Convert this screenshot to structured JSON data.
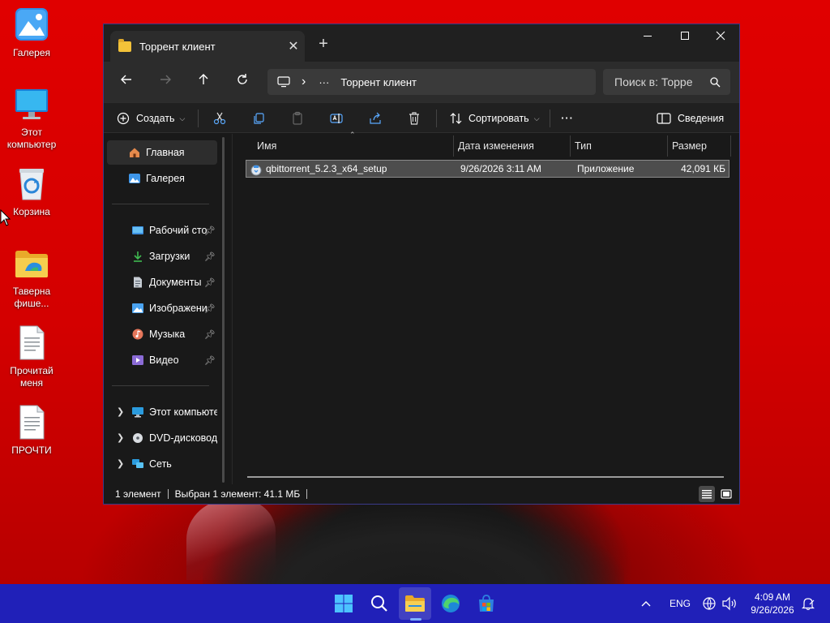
{
  "desktop": {
    "icons": [
      {
        "label": "Галерея",
        "icon": "gallery-icon"
      },
      {
        "label": "Этот компьютер",
        "icon": "monitor-icon"
      },
      {
        "label": "Корзина",
        "icon": "recycle-bin-icon"
      },
      {
        "label": "Таверна фише...",
        "icon": "folder-icon"
      },
      {
        "label": "Прочитай меня",
        "icon": "document-icon"
      },
      {
        "label": "ПРОЧТИ",
        "icon": "document-icon"
      }
    ]
  },
  "window": {
    "tab_title": "Торрент клиент",
    "new_tab_symbol": "+",
    "address": {
      "pc_icon": "monitor-icon",
      "separator": "›",
      "overflow": "···",
      "current_folder": "Торрент клиент"
    },
    "search_placeholder": "Поиск в: Торре",
    "toolbar": {
      "create_label": "Создать",
      "sort_label": "Сортировать",
      "more_label": "···",
      "details_label": "Сведения"
    },
    "sidebar": {
      "home": "Главная",
      "gallery": "Галерея",
      "quick": [
        {
          "label": "Рабочий сто",
          "icon": "desktop-icon",
          "color": "#3b8fe0"
        },
        {
          "label": "Загрузки",
          "icon": "download-icon",
          "color": "#3fb950"
        },
        {
          "label": "Документы",
          "icon": "documents-icon",
          "color": "#9aa4b2"
        },
        {
          "label": "Изображени",
          "icon": "pictures-icon",
          "color": "#4aa3f0"
        },
        {
          "label": "Музыка",
          "icon": "music-icon",
          "color": "#e5765a"
        },
        {
          "label": "Видео",
          "icon": "video-icon",
          "color": "#8b6bd6"
        }
      ],
      "tree": [
        {
          "label": "Этот компьюте",
          "icon": "monitor-icon"
        },
        {
          "label": "DVD-дисковод (",
          "icon": "dvd-icon"
        },
        {
          "label": "Сеть",
          "icon": "network-icon"
        }
      ]
    },
    "columns": {
      "name": "Имя",
      "modified": "Дата изменения",
      "type": "Тип",
      "size": "Размер"
    },
    "files": [
      {
        "name": "qbittorrent_5.2.3_x64_setup",
        "modified": "9/26/2026 3:11 AM",
        "type": "Приложение",
        "size": "42,091 КБ"
      }
    ],
    "status": {
      "count": "1 элемент",
      "selection": "Выбран 1 элемент: 41.1 МБ"
    }
  },
  "taskbar": {
    "language": "ENG",
    "time": "4:09 AM",
    "date": "9/26/2026",
    "accent": "#2020b8"
  }
}
